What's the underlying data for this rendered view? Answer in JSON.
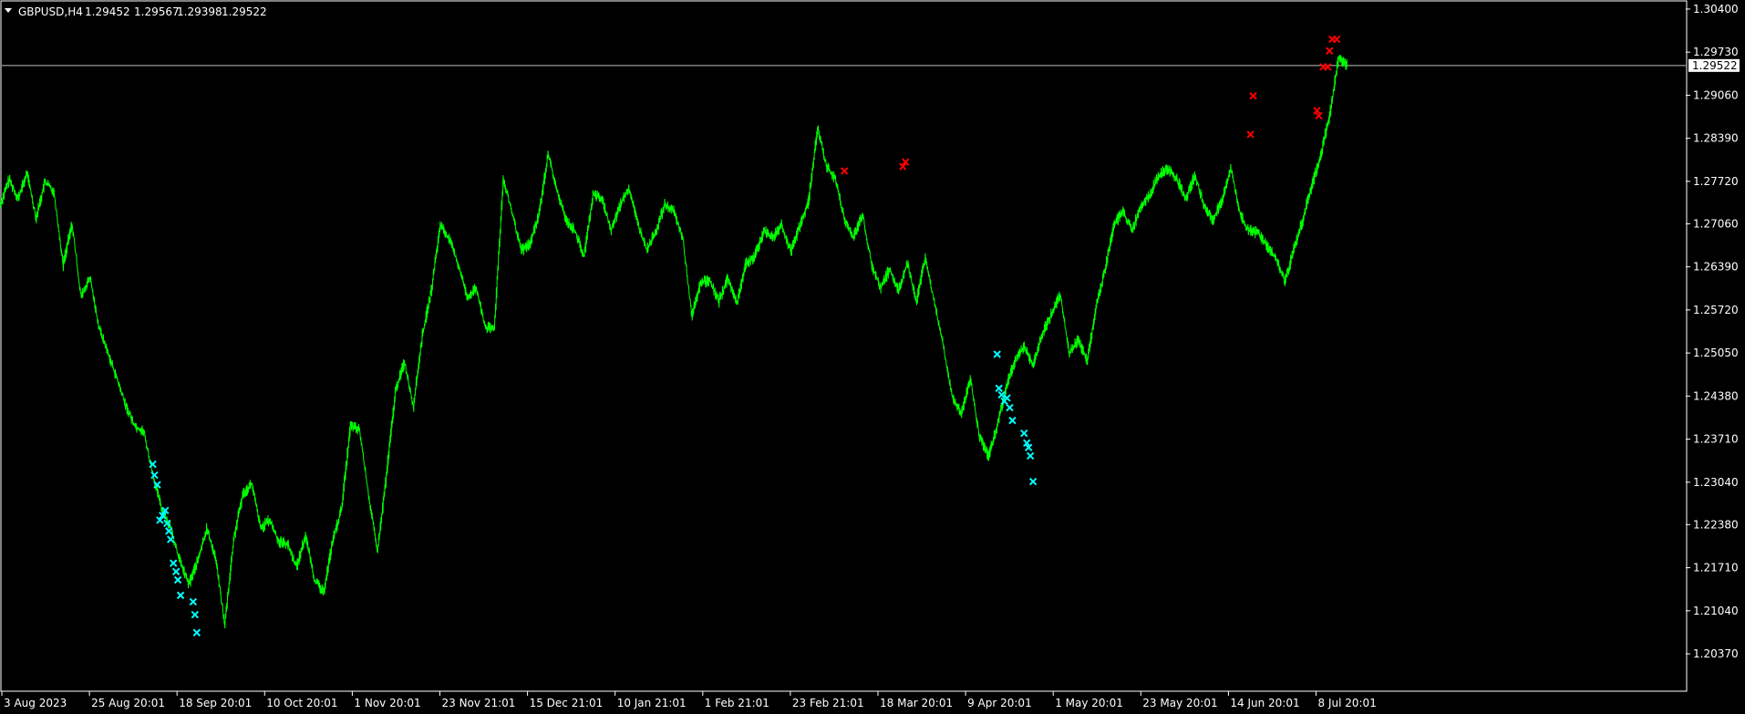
{
  "header": {
    "symbol_timeframe": "GBPUSD,H4",
    "open": "1.29452",
    "high": "1.29567",
    "low": "1.29398",
    "close": "1.29522"
  },
  "colors": {
    "background": "#000000",
    "price_line": "#00ff00",
    "axis": "#ffffff",
    "bid_line": "#c0c0c0",
    "bid_label_bg": "#ffffff",
    "marker_sell": "#ff0000",
    "marker_buy": "#00ffff"
  },
  "icons": {
    "dropdown": "triangle-down-icon"
  },
  "chart_data": {
    "type": "line",
    "title": "GBPUSD,H4",
    "ylim": [
      1.2003,
      1.3047
    ],
    "y_ticks": [
      "1.30400",
      "1.29730",
      "1.29060",
      "1.28390",
      "1.27720",
      "1.27060",
      "1.26390",
      "1.25720",
      "1.25050",
      "1.24380",
      "1.23710",
      "1.23040",
      "1.22380",
      "1.21710",
      "1.21040",
      "1.20370"
    ],
    "x_ticks": [
      "3 Aug 2023",
      "25 Aug 20:01",
      "18 Sep 20:01",
      "10 Oct 20:01",
      "1 Nov 20:01",
      "23 Nov 21:01",
      "15 Dec 21:01",
      "10 Jan 21:01",
      "1 Feb 21:01",
      "23 Feb 21:01",
      "18 Mar 20:01",
      "9 Apr 20:01",
      "1 May 20:01",
      "23 May 20:01",
      "14 Jun 20:01",
      "8 Jul 20:01"
    ],
    "bid_price": 1.29522,
    "bid_label": "1.29522",
    "series": [
      {
        "x": [
          0,
          1,
          2,
          3,
          4,
          5,
          6,
          7,
          8,
          9,
          10,
          11,
          12,
          13,
          14,
          15,
          16,
          17,
          18,
          19,
          20,
          21,
          22,
          23,
          24,
          25,
          26,
          27,
          28,
          29,
          30,
          31,
          32,
          33,
          34,
          35,
          36,
          37,
          38,
          39,
          40,
          41,
          42,
          43,
          44,
          45,
          46,
          47,
          48,
          49,
          50,
          51,
          52,
          53,
          54,
          55,
          56,
          57,
          58,
          59,
          60,
          61,
          62,
          63,
          64,
          65,
          66,
          67,
          68,
          69,
          70,
          71,
          72,
          73,
          74,
          75,
          76,
          77,
          78,
          79,
          80,
          81,
          82,
          83,
          84,
          85,
          86,
          87,
          88,
          89,
          90,
          91,
          92,
          93,
          94,
          95,
          96,
          97,
          98,
          99,
          100,
          101,
          102,
          103,
          104,
          105,
          106,
          107,
          108,
          109,
          110,
          111,
          112,
          113,
          114,
          115,
          116,
          117,
          118,
          119,
          120,
          121,
          122,
          123,
          124,
          125,
          126,
          127,
          128,
          129,
          130,
          131,
          132,
          133,
          134,
          135,
          136,
          137,
          138,
          139,
          140,
          141,
          142,
          143,
          144,
          145,
          146,
          147,
          148,
          149,
          150
        ],
        "y": [
          1.2735,
          1.2775,
          1.2745,
          1.2785,
          1.2715,
          1.2772,
          1.2755,
          1.2642,
          1.2706,
          1.2592,
          1.2622,
          1.2545,
          1.2505,
          1.2465,
          1.2422,
          1.2392,
          1.2382,
          1.2315,
          1.2262,
          1.2232,
          1.2182,
          1.2145,
          1.2182,
          1.2232,
          1.2185,
          1.2082,
          1.2215,
          1.2285,
          1.2302,
          1.2232,
          1.2245,
          1.2212,
          1.2208,
          1.2172,
          1.2222,
          1.2152,
          1.2132,
          1.2212,
          1.2262,
          1.2392,
          1.2385,
          1.2285,
          1.2195,
          1.2315,
          1.2445,
          1.2492,
          1.2422,
          1.2532,
          1.2602,
          1.2705,
          1.2682,
          1.2642,
          1.2592,
          1.2605,
          1.2545,
          1.2542,
          1.2775,
          1.2722,
          1.2664,
          1.2675,
          1.2722,
          1.2815,
          1.2755,
          1.2712,
          1.2695,
          1.2655,
          1.2752,
          1.2745,
          1.2695,
          1.2735,
          1.2762,
          1.2706,
          1.2665,
          1.2695,
          1.2735,
          1.2725,
          1.2682,
          1.2562,
          1.2615,
          1.2618,
          1.2585,
          1.2622,
          1.2582,
          1.2645,
          1.2655,
          1.2695,
          1.2685,
          1.2705,
          1.2662,
          1.2702,
          1.2742,
          1.2855,
          1.2795,
          1.2775,
          1.2712,
          1.2685,
          1.2722,
          1.2642,
          1.2606,
          1.2635,
          1.2602,
          1.2645,
          1.2585,
          1.2655,
          1.2582,
          1.2515,
          1.2435,
          1.2412,
          1.2465,
          1.2375,
          1.2345,
          1.2392,
          1.2452,
          1.2495,
          1.2515,
          1.2485,
          1.2535,
          1.2565,
          1.2595,
          1.2505,
          1.2525,
          1.2492,
          1.2578,
          1.2635,
          1.2705,
          1.2725,
          1.2695,
          1.2735,
          1.2752,
          1.2782,
          1.2792,
          1.2775,
          1.2745,
          1.2782,
          1.2735,
          1.2712,
          1.2742,
          1.2792,
          1.2722,
          1.2695,
          1.2692,
          1.2672,
          1.2652,
          1.2615,
          1.2665,
          1.2712,
          1.2765,
          1.2812,
          1.2875,
          1.2965,
          1.2952
        ]
      }
    ],
    "sell_markers": [
      {
        "x": 94.0,
        "y": 1.2788
      },
      {
        "x": 100.5,
        "y": 1.2795
      },
      {
        "x": 100.8,
        "y": 1.2802
      },
      {
        "x": 139.5,
        "y": 1.2905
      },
      {
        "x": 139.2,
        "y": 1.2845
      },
      {
        "x": 146.6,
        "y": 1.2882
      },
      {
        "x": 146.8,
        "y": 1.2874
      },
      {
        "x": 147.3,
        "y": 1.295
      },
      {
        "x": 147.8,
        "y": 1.295
      },
      {
        "x": 148.0,
        "y": 1.2975
      },
      {
        "x": 148.3,
        "y": 1.2993
      },
      {
        "x": 148.8,
        "y": 1.2993
      }
    ],
    "buy_markers": [
      {
        "x": 17.0,
        "y": 1.2332
      },
      {
        "x": 17.2,
        "y": 1.2315
      },
      {
        "x": 17.5,
        "y": 1.23
      },
      {
        "x": 17.8,
        "y": 1.2245
      },
      {
        "x": 18.1,
        "y": 1.2252
      },
      {
        "x": 18.4,
        "y": 1.226
      },
      {
        "x": 18.6,
        "y": 1.224
      },
      {
        "x": 18.8,
        "y": 1.2228
      },
      {
        "x": 19.0,
        "y": 1.2215
      },
      {
        "x": 19.3,
        "y": 1.2178
      },
      {
        "x": 19.6,
        "y": 1.2165
      },
      {
        "x": 19.8,
        "y": 1.2152
      },
      {
        "x": 20.1,
        "y": 1.2128
      },
      {
        "x": 21.5,
        "y": 1.2118
      },
      {
        "x": 21.7,
        "y": 1.2098
      },
      {
        "x": 21.9,
        "y": 1.207
      },
      {
        "x": 111.0,
        "y": 1.2503
      },
      {
        "x": 111.2,
        "y": 1.245
      },
      {
        "x": 111.5,
        "y": 1.244
      },
      {
        "x": 111.8,
        "y": 1.243
      },
      {
        "x": 112.1,
        "y": 1.2435
      },
      {
        "x": 112.4,
        "y": 1.242
      },
      {
        "x": 112.7,
        "y": 1.24
      },
      {
        "x": 114.0,
        "y": 1.238
      },
      {
        "x": 114.3,
        "y": 1.2365
      },
      {
        "x": 114.5,
        "y": 1.2358
      },
      {
        "x": 114.7,
        "y": 1.2345
      },
      {
        "x": 115.0,
        "y": 1.2305
      }
    ]
  }
}
